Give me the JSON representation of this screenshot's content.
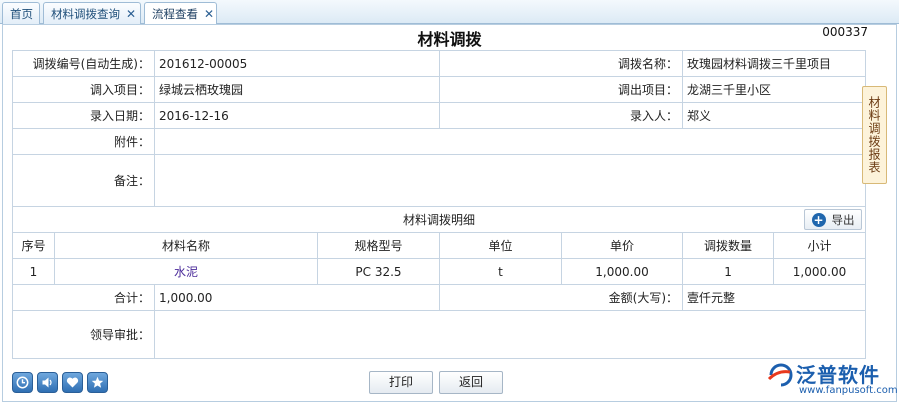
{
  "tabs": [
    {
      "label": "首页",
      "closable": false
    },
    {
      "label": "材料调拨查询",
      "closable": true
    },
    {
      "label": "流程查看",
      "closable": true
    }
  ],
  "form": {
    "title": "材料调拨",
    "doc_no": "000337",
    "fields": {
      "code_label": "调拨编号(自动生成)：",
      "code_value": "201612-00005",
      "name_label": "调拨名称：",
      "name_value": "玫瑰园材料调拨三千里项目",
      "in_project_label": "调入项目：",
      "in_project_value": "绿城云栖玫瑰园",
      "out_project_label": "调出项目：",
      "out_project_value": "龙湖三千里小区",
      "date_label": "录入日期：",
      "date_value": "2016-12-16",
      "entered_by_label": "录入人：",
      "entered_by_value": "郑义",
      "attachment_label": "附件：",
      "remark_label": "备注："
    },
    "detail": {
      "title": "材料调拨明细",
      "export_label": "导出",
      "columns": [
        "序号",
        "材料名称",
        "规格型号",
        "单位",
        "单价",
        "调拨数量",
        "小计"
      ],
      "rows": [
        {
          "no": "1",
          "name": "水泥",
          "spec": "PC 32.5",
          "unit": "t",
          "price": "1,000.00",
          "qty": "1",
          "subtotal": "1,000.00"
        }
      ]
    },
    "total_label": "合计：",
    "total_value": "1,000.00",
    "amount_cn_label": "金额(大写)：",
    "amount_cn_value": "壹仟元整",
    "approval_label": "领导审批："
  },
  "side_tab": "材料调拨报表",
  "buttons": {
    "print": "打印",
    "back": "返回"
  },
  "bottom_icons": [
    "clock-icon",
    "speaker-icon",
    "heart-icon",
    "star-icon"
  ],
  "logo": {
    "name": "泛普软件",
    "url": "www.fanpusoft.com"
  },
  "colors": {
    "accent": "#1f66ad",
    "link_purple": "#4b2b9a",
    "side_tab_bg": "#fdf3da"
  }
}
